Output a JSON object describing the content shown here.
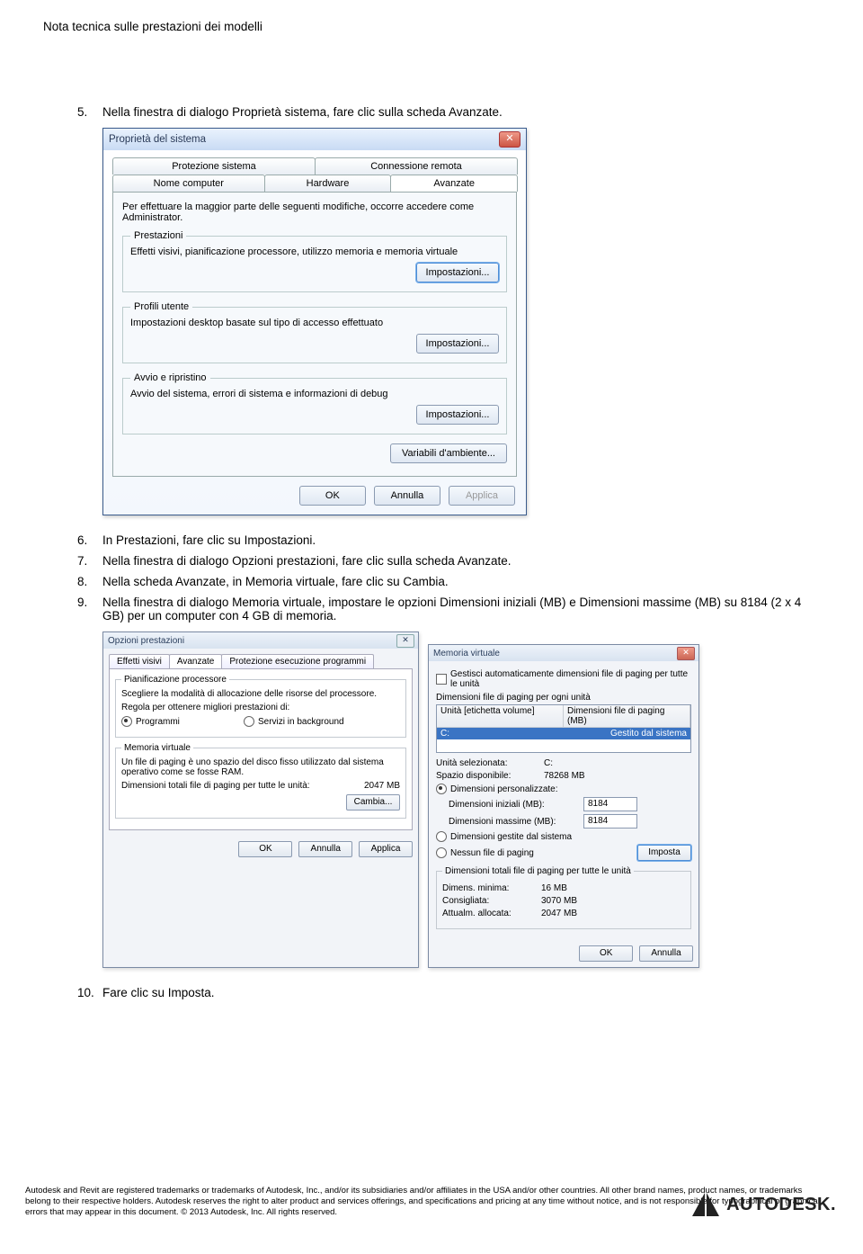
{
  "doc": {
    "header": "Nota tecnica sulle prestazioni dei modelli",
    "steps": {
      "s5_num": "5.",
      "s5": "Nella finestra di dialogo Proprietà sistema, fare clic sulla scheda Avanzate.",
      "s6_num": "6.",
      "s6": "In Prestazioni, fare clic su Impostazioni.",
      "s7_num": "7.",
      "s7": "Nella finestra di dialogo Opzioni prestazioni, fare clic sulla scheda Avanzate.",
      "s8_num": "8.",
      "s8": "Nella scheda Avanzate, in Memoria virtuale, fare clic su Cambia.",
      "s9_num": "9.",
      "s9": "Nella finestra di dialogo Memoria virtuale, impostare le opzioni Dimensioni iniziali (MB) e Dimensioni massime (MB) su 8184 (2 x 4 GB) per un computer con 4 GB di memoria.",
      "s10_num": "10.",
      "s10": "Fare clic su Imposta."
    },
    "footer": "Autodesk and Revit are registered trademarks or trademarks of Autodesk, Inc., and/or its subsidiaries and/or affiliates in the USA and/or other countries. All other brand names, product names, or trademarks belong to their respective holders. Autodesk reserves the right to alter product and services offerings, and specifications and pricing at any time without notice, and is not responsible for typographical or graphical errors that may appear in this document. © 2013 Autodesk, Inc. All rights reserved.",
    "logo": "AUTODESK."
  },
  "dlg1": {
    "title": "Proprietà del sistema",
    "close": "✕",
    "tabs_row1": [
      "Protezione sistema",
      "Connessione remota"
    ],
    "tabs_row2": [
      "Nome computer",
      "Hardware",
      "Avanzate"
    ],
    "intro": "Per effettuare la maggior parte delle seguenti modifiche, occorre accedere come Administrator.",
    "fs1_legend": "Prestazioni",
    "fs1_desc": "Effetti visivi, pianificazione processore, utilizzo memoria e memoria virtuale",
    "fs2_legend": "Profili utente",
    "fs2_desc": "Impostazioni desktop basate sul tipo di accesso effettuato",
    "fs3_legend": "Avvio e ripristino",
    "fs3_desc": "Avvio del sistema, errori di sistema e informazioni di debug",
    "settings_btn": "Impostazioni...",
    "envvars_btn": "Variabili d'ambiente...",
    "ok": "OK",
    "cancel": "Annulla",
    "apply": "Applica"
  },
  "dlg2": {
    "title": "Opzioni prestazioni",
    "x": "✕",
    "tabs": [
      "Effetti visivi",
      "Avanzate",
      "Protezione esecuzione programmi"
    ],
    "fs1_legend": "Pianificazione processore",
    "fs1_l1": "Scegliere la modalità di allocazione delle risorse del processore.",
    "fs1_l2": "Regola per ottenere migliori prestazioni di:",
    "fs1_r1": "Programmi",
    "fs1_r2": "Servizi in background",
    "fs2_legend": "Memoria virtuale",
    "fs2_l1": "Un file di paging è uno spazio del disco fisso utilizzato dal sistema operativo come se fosse RAM.",
    "fs2_l2": "Dimensioni totali file di paging per tutte le unità:",
    "fs2_val": "2047 MB",
    "change_btn": "Cambia...",
    "ok": "OK",
    "cancel": "Annulla",
    "apply": "Applica"
  },
  "dlg3": {
    "title": "Memoria virtuale",
    "x": "✕",
    "auto": "Gestisci automaticamente dimensioni file di paging per tutte le unità",
    "per_drive": "Dimensioni file di paging per ogni unità",
    "col1": "Unità [etichetta volume]",
    "col2": "Dimensioni file di paging (MB)",
    "drive": "C:",
    "drive_status": "Gestito dal sistema",
    "sel_drive_lbl": "Unità selezionata:",
    "sel_drive_val": "C:",
    "space_lbl": "Spazio disponibile:",
    "space_val": "78268 MB",
    "opt1": "Dimensioni personalizzate:",
    "init_lbl": "Dimensioni iniziali (MB):",
    "init_val": "8184",
    "max_lbl": "Dimensioni massime (MB):",
    "max_val": "8184",
    "opt2": "Dimensioni gestite dal sistema",
    "opt3": "Nessun file di paging",
    "set_btn": "Imposta",
    "totals_legend": "Dimensioni totali file di paging per tutte le unità",
    "min_lbl": "Dimens. minima:",
    "min_val": "16 MB",
    "rec_lbl": "Consigliata:",
    "rec_val": "3070 MB",
    "cur_lbl": "Attualm. allocata:",
    "cur_val": "2047 MB",
    "ok": "OK",
    "cancel": "Annulla"
  }
}
